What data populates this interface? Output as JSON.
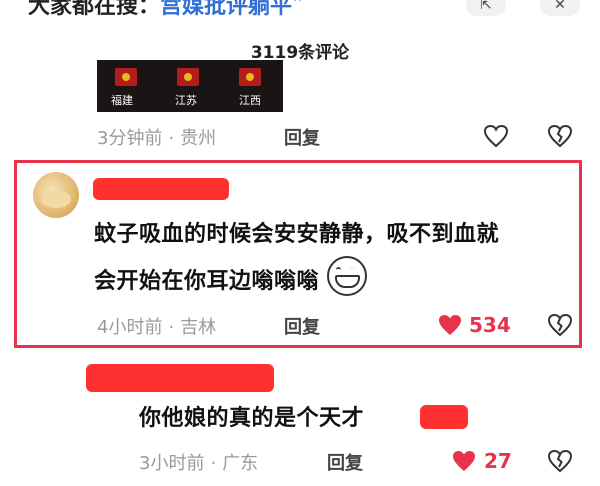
{
  "header": {
    "title_prefix": "大家都在搜：",
    "title_search": "宫媒批评躺平",
    "comment_count": "3119条评论"
  },
  "prev_comment": {
    "image_provinces": [
      "福建",
      "江苏",
      "江西"
    ],
    "time": "3分钟前",
    "location": "贵州",
    "reply_label": "回复"
  },
  "highlight_comment": {
    "text_line1": "蚊子吸血的时候会安安静静，吸不到血就",
    "text_line2": "会开始在你耳边嗡嗡嗡",
    "time": "4小时前",
    "location": "吉林",
    "reply_label": "回复",
    "like_count": "534"
  },
  "reply_comment": {
    "text": "你他娘的真的是个天才",
    "time": "3小时前",
    "location": "广东",
    "reply_label": "回复",
    "like_count": "27"
  },
  "colors": {
    "accent_red": "#e8344a",
    "redact_red": "#ff3030",
    "meta_gray": "#9a9a9a"
  },
  "icons": {
    "like": "heart-icon",
    "dislike": "broken-heart-icon"
  }
}
